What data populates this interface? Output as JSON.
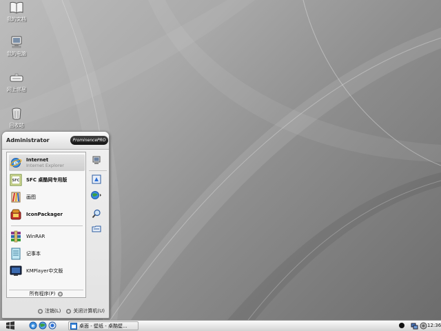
{
  "desktop": {
    "icons": [
      {
        "label": "我的文档",
        "icon": "my-documents-icon"
      },
      {
        "label": "我的电脑",
        "icon": "my-computer-icon"
      },
      {
        "label": "网上邻居",
        "icon": "network-icon"
      },
      {
        "label": "回收站",
        "icon": "recycle-bin-icon"
      }
    ]
  },
  "start_menu": {
    "user": "Administrator",
    "brand": "ProminencePRO",
    "pinned": [
      {
        "title": "Internet",
        "subtitle": "Internet Explorer",
        "icon": "ie-icon"
      },
      {
        "title": "SFC 桌酷网专用版",
        "icon": "sfc-icon"
      },
      {
        "title": "画图",
        "icon": "paint-icon"
      },
      {
        "title": "IconPackager",
        "icon": "iconpackager-icon"
      }
    ],
    "recent": [
      {
        "title": "WinRAR",
        "icon": "winrar-icon"
      },
      {
        "title": "记事本",
        "icon": "notepad-icon"
      },
      {
        "title": "KMPlayer中文版",
        "icon": "kmplayer-icon"
      }
    ],
    "all_programs": "所有程序(P)",
    "right_icons": [
      "monitor-icon",
      "control-panel-icon",
      "globe-icon",
      "search-icon",
      "run-icon"
    ],
    "logoff": "注销(L)",
    "shutdown": "关闭计算机(U)"
  },
  "taskbar": {
    "task_label": "桌面 - 壁纸 - 桌酷壁...",
    "clock": "12:36"
  },
  "colors": {
    "accent": "#2a6fd6",
    "taskbar": "#e5e5e5"
  }
}
